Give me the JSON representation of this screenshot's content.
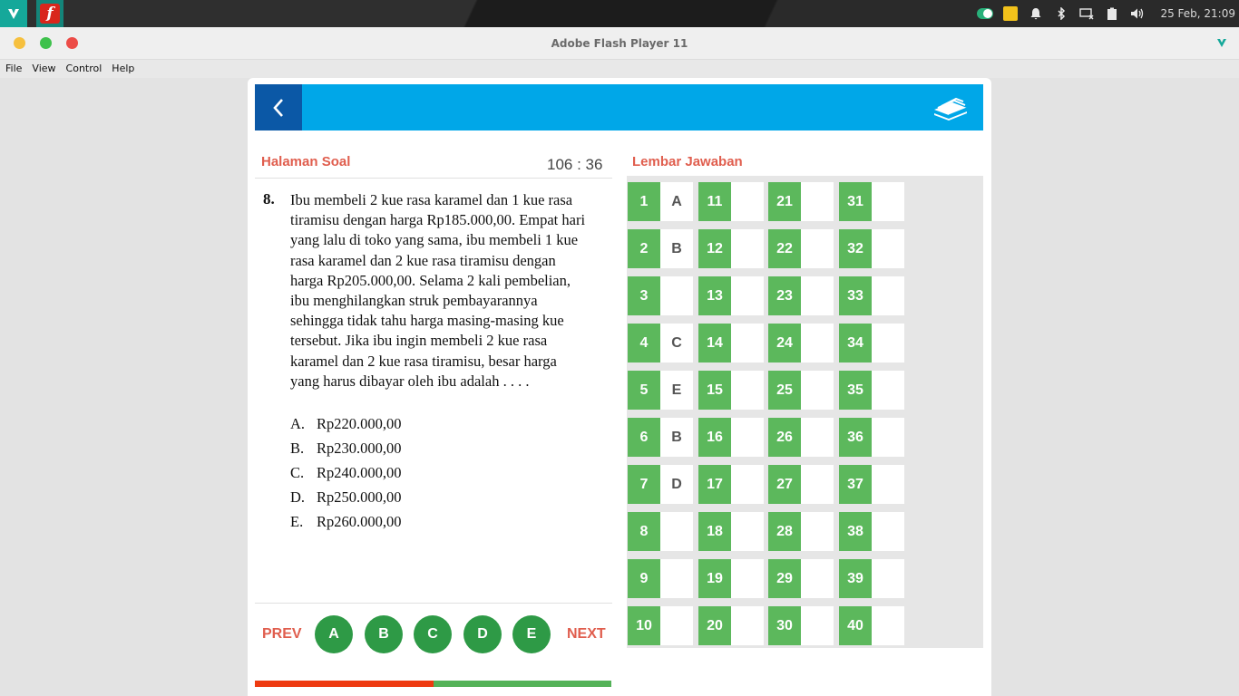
{
  "taskbar": {
    "clock": "25 Feb, 21:09"
  },
  "window": {
    "title": "Adobe Flash Player 11"
  },
  "menu": [
    "File",
    "View",
    "Control",
    "Help"
  ],
  "question_page": {
    "title": "Halaman Soal",
    "timer": "106 : 36",
    "number": "8.",
    "text": "Ibu membeli 2 kue rasa karamel dan 1 kue rasa tiramisu dengan harga Rp185.000,00. Empat hari yang lalu di toko yang sama, ibu membeli 1 kue rasa karamel dan 2 kue rasa tiramisu dengan harga Rp205.000,00. Selama 2 kali pembelian, ibu menghilangkan struk pembayarannya sehingga tidak tahu harga masing-masing kue tersebut. Jika ibu ingin membeli 2 kue rasa karamel dan 2 kue rasa tiramisu, besar harga yang harus dibayar oleh ibu adalah . . . .",
    "options": [
      {
        "letter": "A.",
        "text": "Rp220.000,00"
      },
      {
        "letter": "B.",
        "text": "Rp230.000,00"
      },
      {
        "letter": "C.",
        "text": "Rp240.000,00"
      },
      {
        "letter": "D.",
        "text": "Rp250.000,00"
      },
      {
        "letter": "E.",
        "text": "Rp260.000,00"
      }
    ],
    "prev_label": "PREV",
    "next_label": "NEXT",
    "answer_buttons": [
      "A",
      "B",
      "C",
      "D",
      "E"
    ],
    "progress_fraction": 0.5
  },
  "answer_sheet": {
    "title": "Lembar Jawaban",
    "answers": {
      "1": "A",
      "2": "B",
      "3": "",
      "4": "C",
      "5": "E",
      "6": "B",
      "7": "D",
      "8": "",
      "9": "",
      "10": ""
    },
    "total": 40
  },
  "colors": {
    "accent_blue": "#00a7e8",
    "dark_blue": "#0b58a6",
    "green": "#5cb85c",
    "button_green": "#2e9a46",
    "title_red": "#e05e4e",
    "progress_red": "#ee3a10"
  },
  "icons": {
    "back": "chevron-left-icon",
    "books": "books-icon"
  }
}
